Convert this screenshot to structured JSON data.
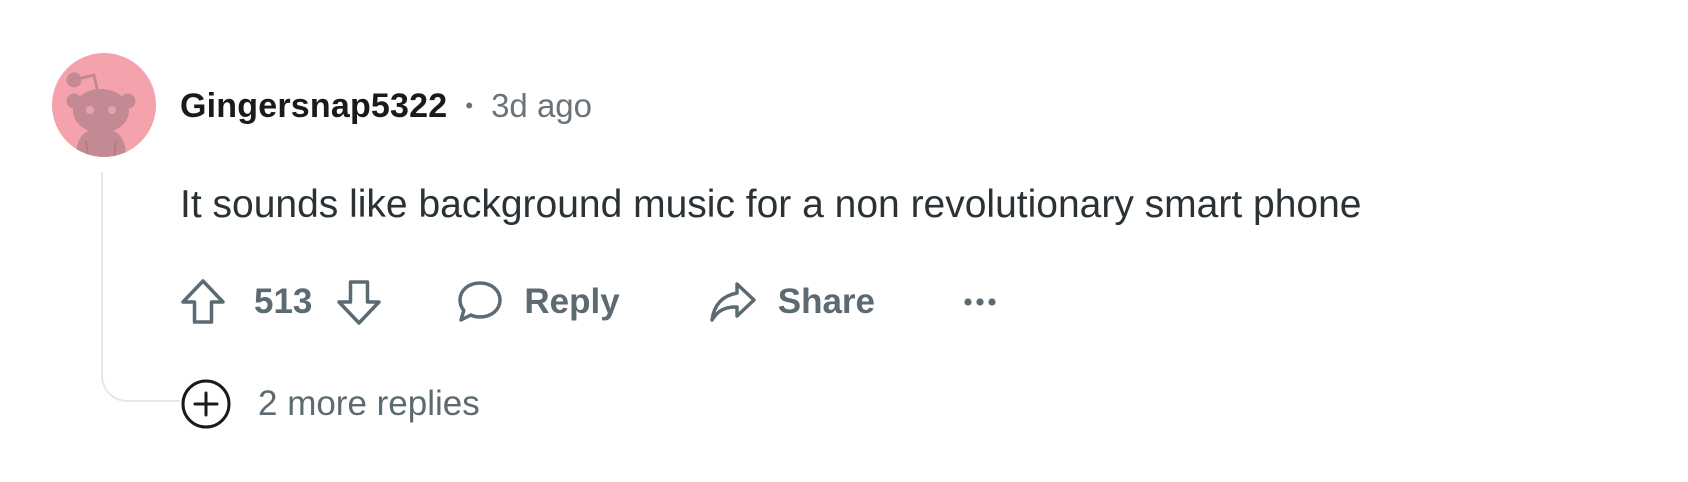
{
  "comment": {
    "author": "Gingersnap5322",
    "separator": "•",
    "time_ago": "3d ago",
    "body": "It sounds like background music for a non revolutionary smart phone",
    "avatar_icon": "snoo-avatar-icon",
    "avatar_color": "#f4a2ac"
  },
  "actions": {
    "upvote_icon": "arrow-up-icon",
    "vote_count": "513",
    "downvote_icon": "arrow-down-icon",
    "reply_icon": "speech-bubble-icon",
    "reply_label": "Reply",
    "share_icon": "share-arrow-icon",
    "share_label": "Share",
    "more_icon": "ellipsis-icon"
  },
  "replies": {
    "expand_icon": "plus-circle-icon",
    "more_label": "2 more replies"
  },
  "colors": {
    "text_primary": "#1a1a1b",
    "text_body": "#2a3236",
    "text_muted": "#5c6a72",
    "thread_line": "#e5e7e9"
  }
}
